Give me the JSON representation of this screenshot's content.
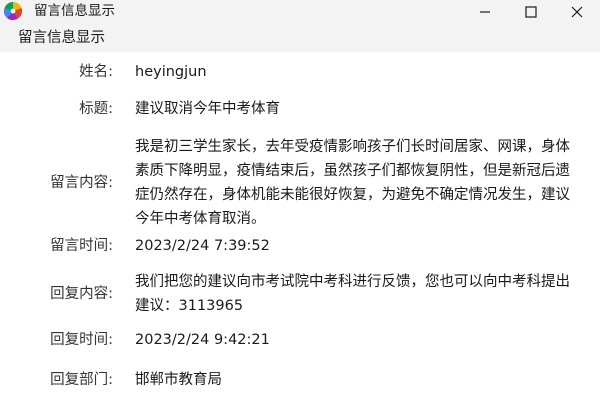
{
  "window": {
    "title": "留言信息显示",
    "icon": "pinwheel-app-icon"
  },
  "menu": {
    "items": [
      "留言信息显示"
    ]
  },
  "fields": {
    "name": {
      "label": "姓名:",
      "value": "heyingjun"
    },
    "subject": {
      "label": "标题:",
      "value": "建议取消今年中考体育"
    },
    "content": {
      "label": "留言内容:",
      "value": "我是初三学生家长，去年受疫情影响孩子们长时间居家、网课，身体素质下降明显，疫情结束后，虽然孩子们都恢复阴性，但是新冠后遗症仍然存在，身体机能未能很好恢复，为避免不确定情况发生，建议今年中考体育取消。"
    },
    "message_time": {
      "label": "留言时间:",
      "value": "2023/2/24 7:39:52"
    },
    "reply_content": {
      "label": "回复内容:",
      "value": "我们把您的建议向市考试院中考科进行反馈，您也可以向中考科提出建议：3113965"
    },
    "reply_time": {
      "label": "回复时间:",
      "value": "2023/2/24 9:42:21"
    },
    "reply_dept": {
      "label": "回复部门:",
      "value": "邯郸市教育局"
    }
  }
}
